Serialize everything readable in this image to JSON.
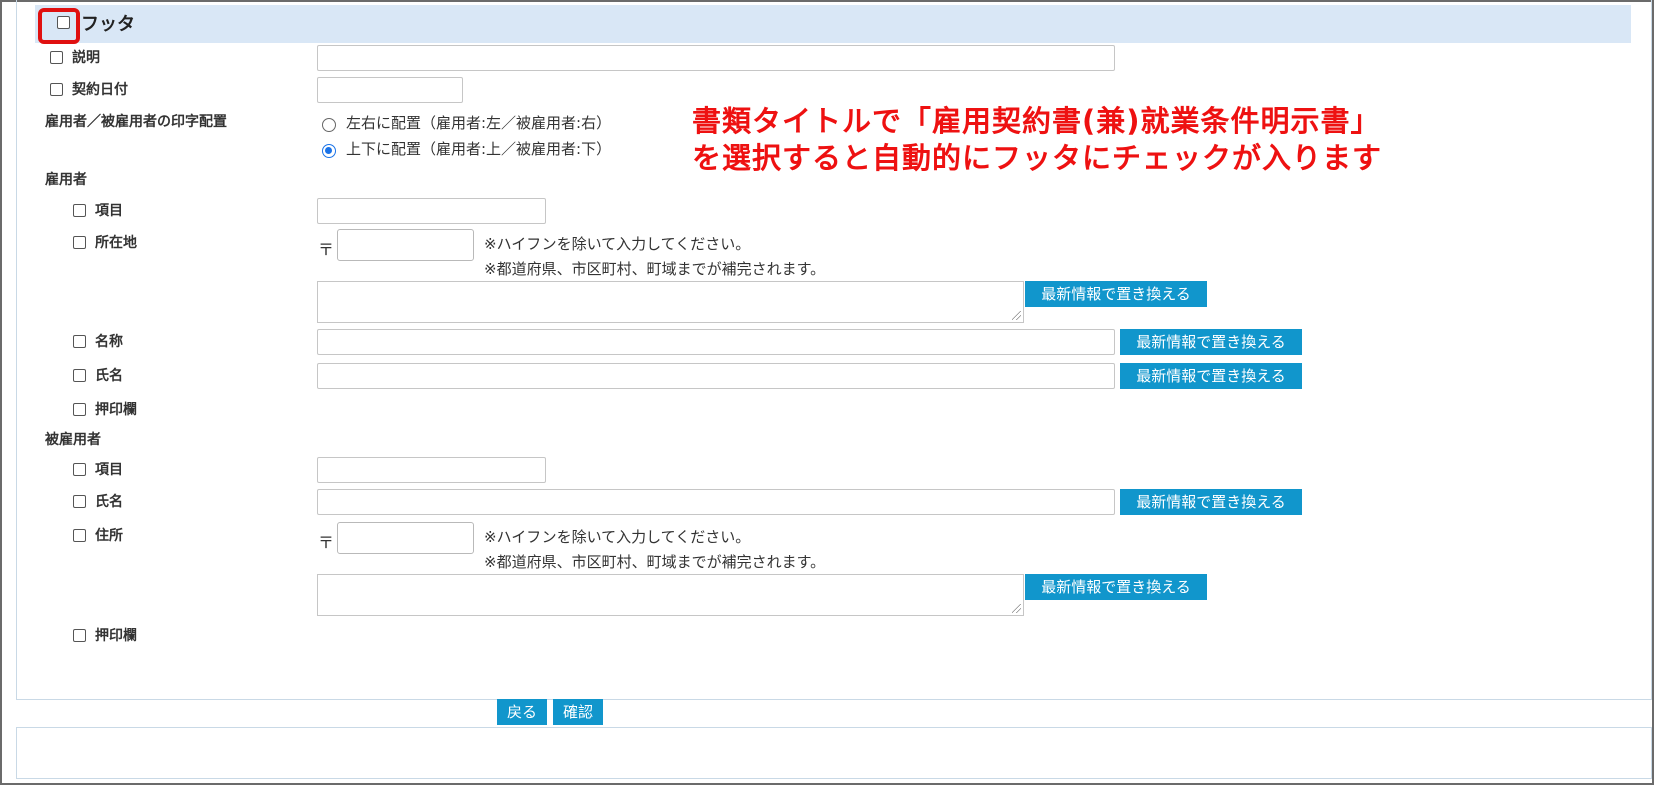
{
  "footer_section": {
    "title": "フッタ",
    "description_label": "説明",
    "contract_date_label": "契約日付",
    "print_layout_label": "雇用者／被雇用者の印字配置",
    "print_layout_options": [
      {
        "label": "左右に配置（雇用者:左／被雇用者:右）",
        "selected": false
      },
      {
        "label": "上下に配置（雇用者:上／被雇用者:下）",
        "selected": true
      }
    ]
  },
  "employer": {
    "heading": "雇用者",
    "item_label": "項目",
    "address_label": "所在地",
    "name_label": "名称",
    "person_label": "氏名",
    "seal_label": "押印欄"
  },
  "employee": {
    "heading": "被雇用者",
    "item_label": "項目",
    "person_label": "氏名",
    "address_label": "住所",
    "seal_label": "押印欄"
  },
  "common": {
    "postal_mark": "〒",
    "zip_note_1": "※ハイフンを除いて入力してください。",
    "zip_note_2": "※都道府県、市区町村、町域までが補完されます。",
    "replace_button": "最新情報で置き換える"
  },
  "annotation": {
    "line1": "書類タイトルで「雇用契約書(兼)就業条件明示書」",
    "line2": "を選択すると自動的にフッタにチェックが入ります",
    "color": "#ee1111"
  },
  "actions": {
    "back_label": "戻る",
    "confirm_label": "確認",
    "button_color": "#1196cc"
  }
}
